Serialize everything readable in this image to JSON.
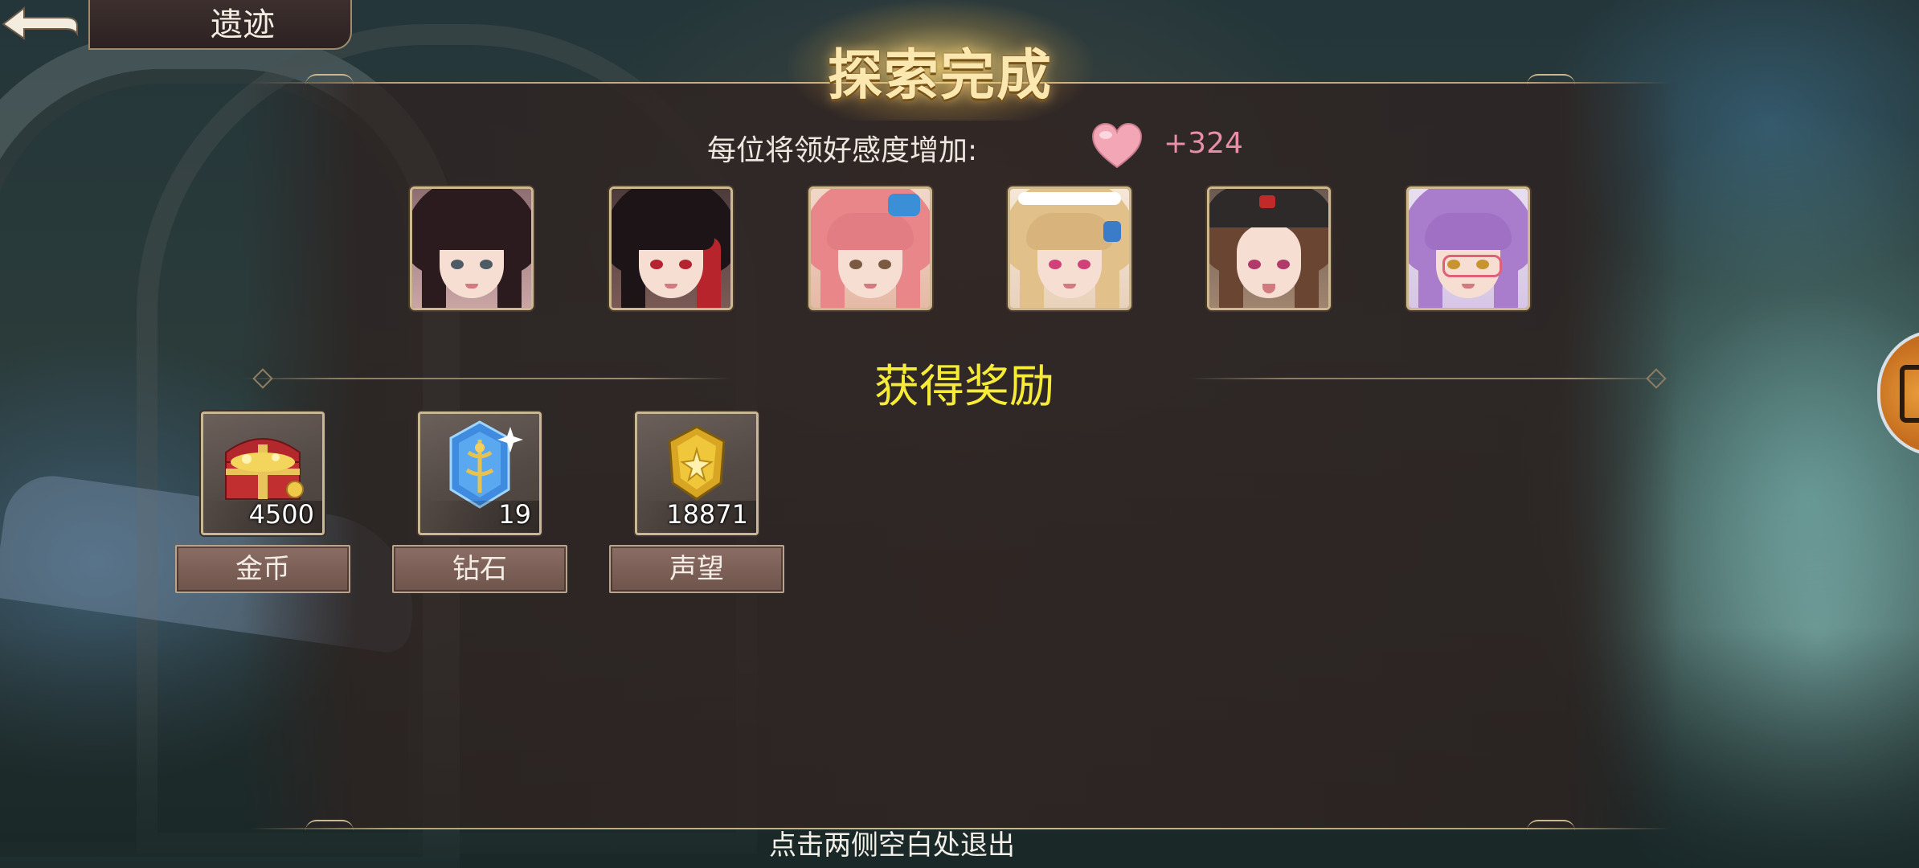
{
  "location": {
    "back_label": "",
    "name": "遗迹"
  },
  "header": {
    "title": "探索完成"
  },
  "favor": {
    "label": "每位将领好感度增加:",
    "value": "+324",
    "icon": "heart-icon"
  },
  "heroes": [
    {
      "name": "hero-portrait-1"
    },
    {
      "name": "hero-portrait-2"
    },
    {
      "name": "hero-portrait-3"
    },
    {
      "name": "hero-portrait-4"
    },
    {
      "name": "hero-portrait-5"
    },
    {
      "name": "hero-portrait-6"
    }
  ],
  "rewards": {
    "title": "获得奖励",
    "items": [
      {
        "label": "金币",
        "count": "4500",
        "icon": "treasure-chest-icon"
      },
      {
        "label": "钻石",
        "count": "19",
        "icon": "diamond-crystal-icon"
      },
      {
        "label": "声望",
        "count": "18871",
        "icon": "prestige-medal-icon"
      }
    ]
  },
  "footer": {
    "hint": "点击两侧空白处退出"
  },
  "colors": {
    "accent_gold": "#cdb78e",
    "reward_title": "#f6ec38",
    "favor_value": "#e98ea8"
  }
}
